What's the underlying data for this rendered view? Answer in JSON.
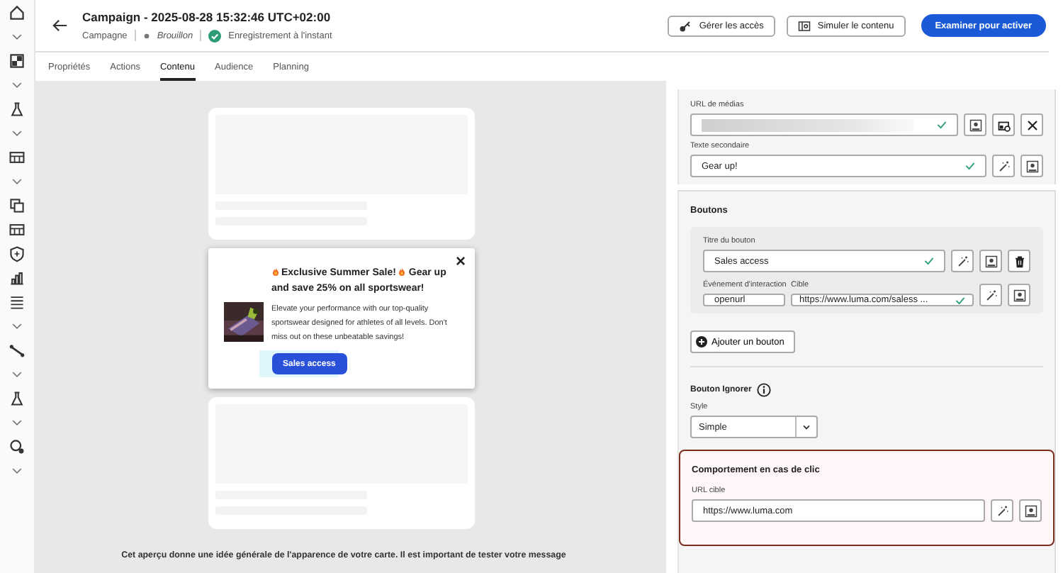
{
  "header": {
    "title": "Campaign - 2025-08-28 15:32:46 UTC+02:00",
    "type": "Campagne",
    "status": "Brouillon",
    "save_state": "Enregistrement à l'instant",
    "saved": true
  },
  "actions": [
    {
      "label": "Gérer les accès",
      "kind": "access"
    },
    {
      "label": "Simuler le contenu",
      "kind": "simulate"
    },
    {
      "label": "Examiner pour activer",
      "kind": "primary"
    }
  ],
  "tabs": [
    {
      "label": "Propriétés",
      "selected": false
    },
    {
      "label": "Actions",
      "selected": false
    },
    {
      "label": "Contenu",
      "selected": true
    },
    {
      "label": "Audience",
      "selected": false
    },
    {
      "label": "Planning",
      "selected": false
    }
  ],
  "preview": {
    "popup": {
      "title_start": "Exclusive Summer Sale!",
      "title_mid": "Gear up",
      "title_end": "and save 25% on all sportswear!",
      "body": "Elevate your performance with our top-quality sportswear designed for athletes of all levels. Don't miss out on these unbeatable savings!",
      "button": "Sales access",
      "close": "×"
    },
    "note": "Cet aperçu donne une idée générale de l'apparence de votre carte. Il est important de tester votre message"
  },
  "media": {
    "url_label": "URL de médias",
    "url_valid": true,
    "secondary_label": "Texte secondaire",
    "secondary_value": "Gear up!",
    "secondary_valid": true
  },
  "buttons_section": {
    "title": "Boutons",
    "items": [
      {
        "title_label": "Titre du bouton",
        "title_value": "Sales access",
        "title_valid": true,
        "event_label": "Événement d'interaction",
        "event_value": "openurl",
        "target_label": "Cible",
        "target_value": "https://www.luma.com/saless ...",
        "target_valid": true
      }
    ],
    "add_label": "Ajouter un bouton"
  },
  "dismiss": {
    "title": "Bouton Ignorer",
    "style_label": "Style",
    "style_value": "Simple"
  },
  "click": {
    "title": "Comportement en cas de clic",
    "url_label": "URL cible",
    "url_value": "https://www.luma.com",
    "highlighted": true
  }
}
